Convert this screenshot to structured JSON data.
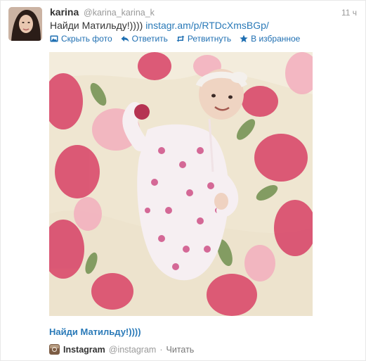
{
  "tweet": {
    "author_name": "karina",
    "author_handle": "@karina_karina_k",
    "time": "11 ч",
    "text": "Найди Матильду!))))",
    "link": "instagr.am/p/RTDcXmsBGp/",
    "actions": [
      {
        "label": "Скрыть фото",
        "icon": "photo-icon"
      },
      {
        "label": "Ответить",
        "icon": "reply-arrow-icon"
      },
      {
        "label": "Ретвитнуть",
        "icon": "retweet-icon"
      },
      {
        "label": "В избранное",
        "icon": "star-icon"
      }
    ]
  },
  "media": {
    "caption": "Найди Матильду!))))",
    "source_name": "Instagram",
    "source_handle": "@instagram",
    "separator": "·",
    "follow_label": "Читать"
  },
  "colors": {
    "link": "#2a7ab8",
    "action": "#1f6fb2",
    "muted": "#999999",
    "flower_pink": "#d94a6c"
  }
}
